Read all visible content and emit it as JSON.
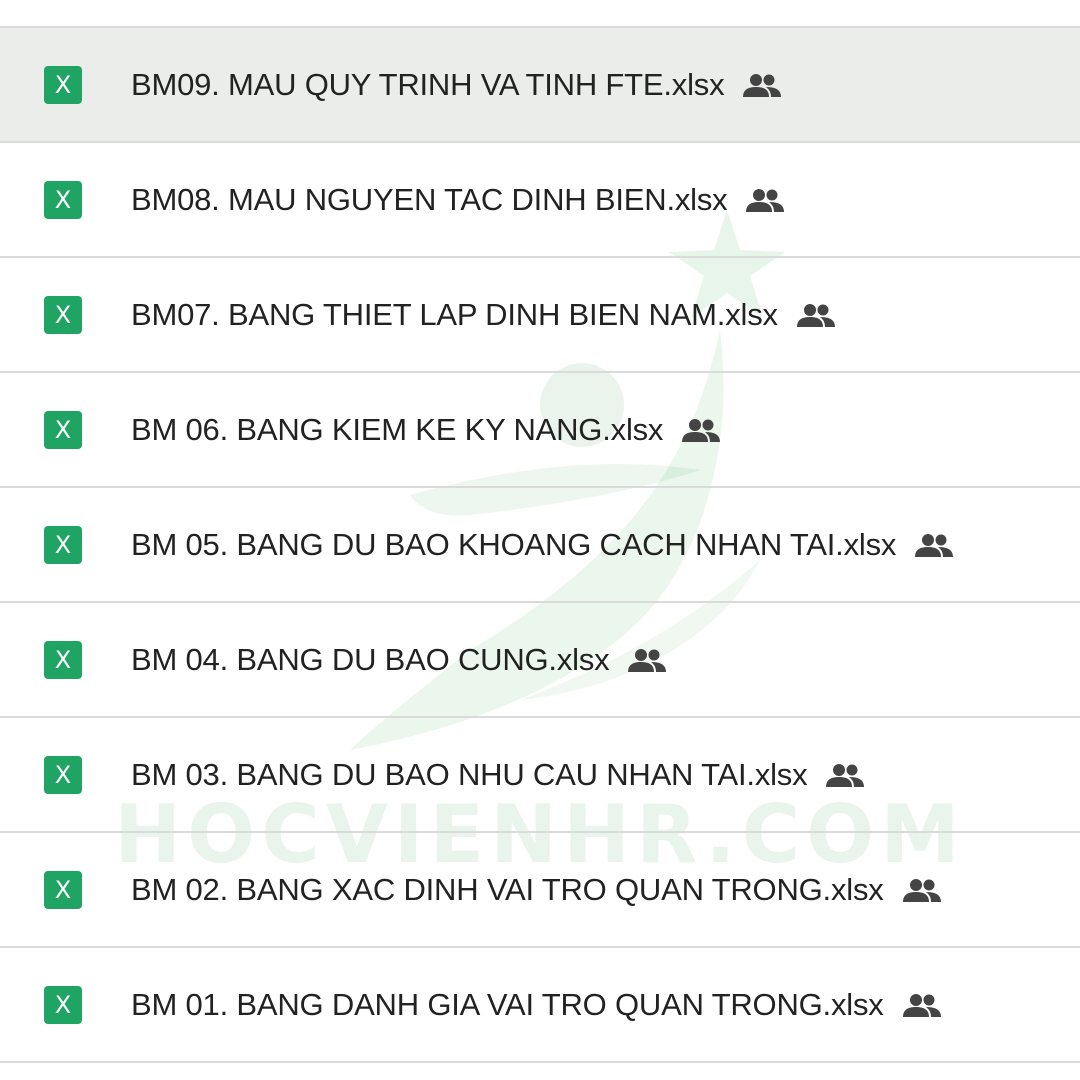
{
  "watermark": {
    "text": "HOCVIENHR.COM"
  },
  "colors": {
    "excel_green": "#1fa463",
    "text": "#222222",
    "divider": "#dadada",
    "selected_row": "#e8eae8",
    "shared_icon": "#444444"
  },
  "files": [
    {
      "name": "BM09. MAU QUY TRINH VA TINH FTE.xlsx",
      "icon": "excel-icon",
      "icon_letter": "X",
      "shared": true,
      "shared_icon": "people-icon",
      "selected": true
    },
    {
      "name": "BM08. MAU NGUYEN TAC DINH BIEN.xlsx",
      "icon": "excel-icon",
      "icon_letter": "X",
      "shared": true,
      "shared_icon": "people-icon",
      "selected": false
    },
    {
      "name": "BM07. BANG THIET LAP DINH BIEN NAM.xlsx",
      "icon": "excel-icon",
      "icon_letter": "X",
      "shared": true,
      "shared_icon": "people-icon",
      "selected": false
    },
    {
      "name": "BM 06. BANG KIEM KE KY NANG.xlsx",
      "icon": "excel-icon",
      "icon_letter": "X",
      "shared": true,
      "shared_icon": "people-icon",
      "selected": false
    },
    {
      "name": "BM 05. BANG DU BAO KHOANG CACH NHAN TAI.xlsx",
      "icon": "excel-icon",
      "icon_letter": "X",
      "shared": true,
      "shared_icon": "people-icon",
      "selected": false
    },
    {
      "name": "BM 04. BANG DU BAO CUNG.xlsx",
      "icon": "excel-icon",
      "icon_letter": "X",
      "shared": true,
      "shared_icon": "people-icon",
      "selected": false
    },
    {
      "name": "BM 03. BANG DU BAO NHU CAU NHAN TAI.xlsx",
      "icon": "excel-icon",
      "icon_letter": "X",
      "shared": true,
      "shared_icon": "people-icon",
      "selected": false
    },
    {
      "name": "BM 02. BANG XAC DINH VAI TRO QUAN TRONG.xlsx",
      "icon": "excel-icon",
      "icon_letter": "X",
      "shared": true,
      "shared_icon": "people-icon",
      "selected": false
    },
    {
      "name": "BM 01. BANG DANH GIA VAI TRO QUAN TRONG.xlsx",
      "icon": "excel-icon",
      "icon_letter": "X",
      "shared": true,
      "shared_icon": "people-icon",
      "selected": false
    }
  ]
}
